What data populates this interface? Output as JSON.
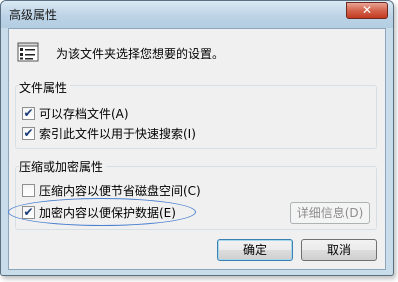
{
  "window": {
    "title": "高级属性",
    "close_glyph": "✕"
  },
  "intro": {
    "icon": "folder-properties-icon",
    "text": "为该文件夹选择您想要的设置。"
  },
  "file_attributes": {
    "title": "文件属性",
    "items": [
      {
        "label": "可以存档文件(A)",
        "checked": true
      },
      {
        "label": "索引此文件以用于快速搜索(I)",
        "checked": true
      }
    ]
  },
  "compress_encrypt": {
    "title": "压缩或加密属性",
    "items": [
      {
        "label": "压缩内容以便节省磁盘空间(C)",
        "checked": false
      },
      {
        "label": "加密内容以便保护数据(E)",
        "checked": true
      }
    ],
    "details_label": "详细信息(D)"
  },
  "buttons": {
    "ok": "确定",
    "cancel": "取消"
  },
  "check_glyph": "✔",
  "colors": {
    "title_bar": "#bdd3e6",
    "close_button": "#c23b21",
    "dialog_background": "#f0f0f0",
    "annotation_ellipse": "#4a7fcf"
  }
}
